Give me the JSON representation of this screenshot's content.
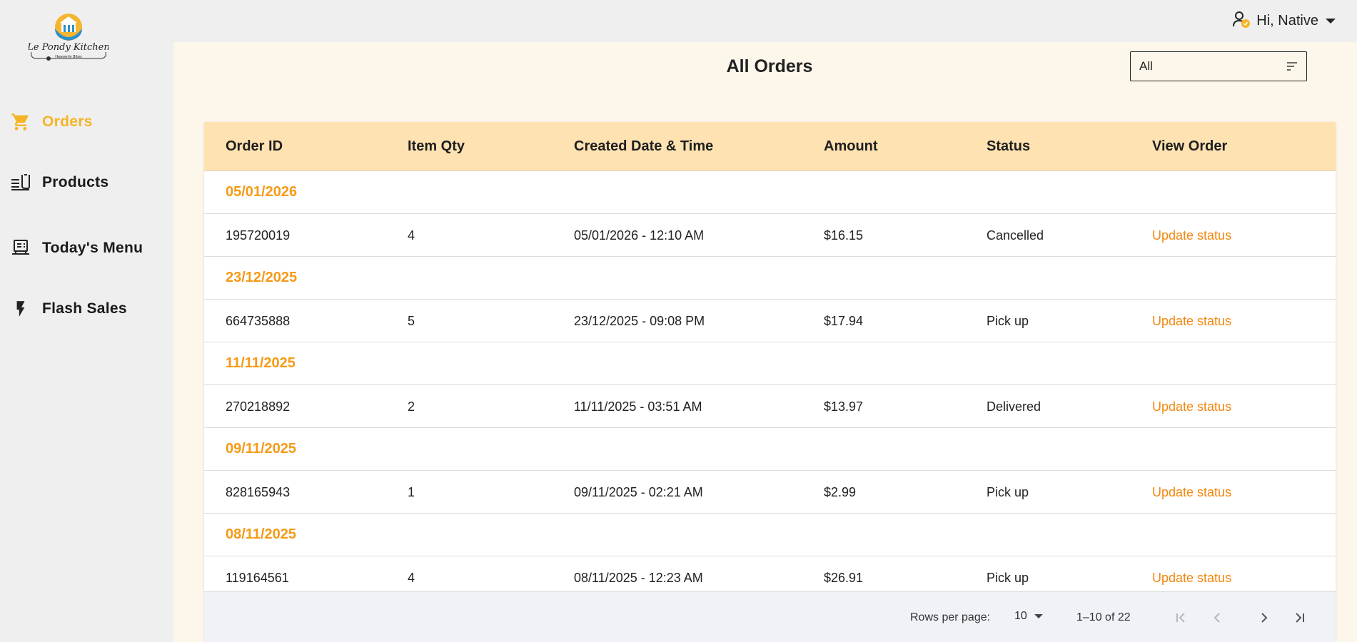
{
  "brand": {
    "name": "Le Pondy Kitchen",
    "tagline": "Heavenly Bites"
  },
  "sidebar": {
    "items": [
      {
        "label": "Orders",
        "icon": "cart-icon",
        "active": true
      },
      {
        "label": "Products",
        "icon": "products-icon",
        "active": false
      },
      {
        "label": "Today's Menu",
        "icon": "menu-icon",
        "active": false
      },
      {
        "label": "Flash Sales",
        "icon": "flash-icon",
        "active": false
      }
    ]
  },
  "header": {
    "greeting": "Hi, Native"
  },
  "main": {
    "title": "All Orders",
    "filter": {
      "value": "All"
    }
  },
  "table": {
    "columns": [
      "Order ID",
      "Item Qty",
      "Created Date & Time",
      "Amount",
      "Status",
      "View Order"
    ],
    "groups": [
      {
        "date": "05/01/2026",
        "orders": [
          {
            "id": "195720019",
            "qty": "4",
            "created": "05/01/2026 - 12:10 AM",
            "amount": "$16.15",
            "status": "Cancelled",
            "action": "Update status"
          }
        ]
      },
      {
        "date": "23/12/2025",
        "orders": [
          {
            "id": "664735888",
            "qty": "5",
            "created": "23/12/2025 - 09:08 PM",
            "amount": "$17.94",
            "status": "Pick up",
            "action": "Update status"
          }
        ]
      },
      {
        "date": "11/11/2025",
        "orders": [
          {
            "id": "270218892",
            "qty": "2",
            "created": "11/11/2025 - 03:51 AM",
            "amount": "$13.97",
            "status": "Delivered",
            "action": "Update status"
          }
        ]
      },
      {
        "date": "09/11/2025",
        "orders": [
          {
            "id": "828165943",
            "qty": "1",
            "created": "09/11/2025 - 02:21 AM",
            "amount": "$2.99",
            "status": "Pick up",
            "action": "Update status"
          }
        ]
      },
      {
        "date": "08/11/2025",
        "orders": [
          {
            "id": "119164561",
            "qty": "4",
            "created": "08/11/2025 - 12:23 AM",
            "amount": "$26.91",
            "status": "Pick up",
            "action": "Update status"
          }
        ]
      }
    ]
  },
  "pagination": {
    "rows_per_page_label": "Rows per page:",
    "rows_per_page": "10",
    "range": "1–10 of 22"
  },
  "colors": {
    "accent": "#f59a16",
    "active_nav": "#f5b427",
    "header_bg": "#ffe2b2",
    "main_bg": "#fdf6ea"
  }
}
